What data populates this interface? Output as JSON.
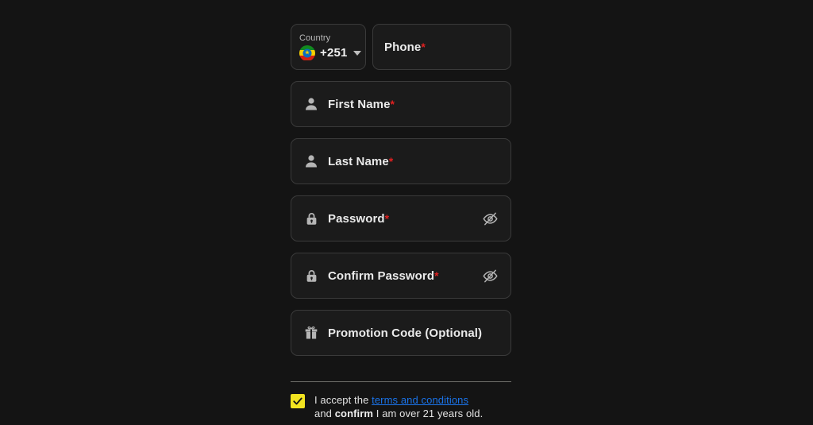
{
  "colors": {
    "page_background": "#141414",
    "field_background": "#1b1b1b",
    "field_border": "#3a3a3a",
    "required_asterisk": "#e02020",
    "link": "#1a73e8",
    "checkbox": "#f2e420",
    "divider": "#6f6f6a",
    "placeholder_text": "#eaeaea",
    "icon": "#b5b5b5"
  },
  "form": {
    "country": {
      "label": "Country",
      "code": "+251",
      "flag_icon": "ethiopia-flag-icon",
      "caret_icon": "chevron-down-icon"
    },
    "phone": {
      "placeholder": "Phone",
      "required_marker": "*"
    },
    "fields": [
      {
        "name": "first-name",
        "placeholder": "First Name",
        "required_marker": "*",
        "icon": "person-icon"
      },
      {
        "name": "last-name",
        "placeholder": "Last Name",
        "required_marker": "*",
        "icon": "person-icon"
      },
      {
        "name": "password",
        "placeholder": "Password",
        "required_marker": "*",
        "icon": "lock-icon",
        "trailing_icon": "eye-off-icon"
      },
      {
        "name": "confirm-password",
        "placeholder": "Confirm Password",
        "required_marker": "*",
        "icon": "lock-icon",
        "trailing_icon": "eye-off-icon"
      },
      {
        "name": "promotion-code",
        "placeholder": "Promotion Code (Optional)",
        "required_marker": "",
        "icon": "gift-icon"
      }
    ]
  },
  "terms": {
    "checkbox_icon": "checkmark-icon",
    "checked": true,
    "line1_prefix": "I accept the ",
    "link_text": "terms and conditions",
    "line2_prefix": "and ",
    "line2_bold": "confirm",
    "line2_suffix": " I am over 21 years old."
  }
}
